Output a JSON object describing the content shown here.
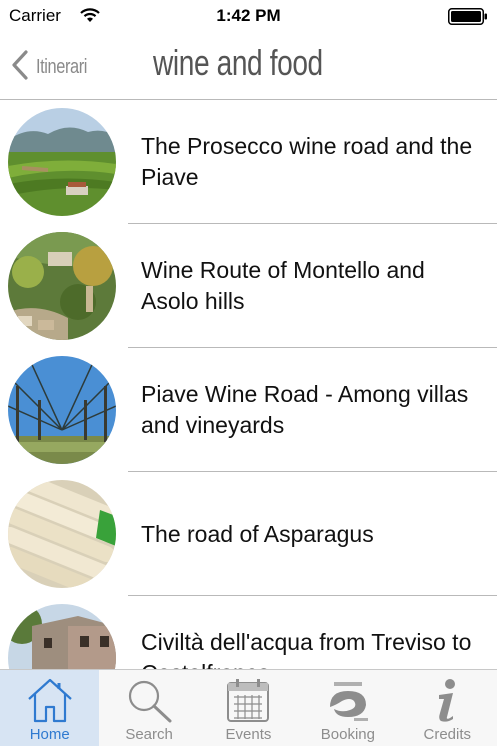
{
  "status_bar": {
    "carrier": "Carrier",
    "time": "1:42 PM"
  },
  "nav": {
    "back_label": "Itinerari",
    "title": "wine and food"
  },
  "items": [
    {
      "title": "The Prosecco wine road and the Piave",
      "thumb": "vineyard-hills-photo"
    },
    {
      "title": "Wine Route of Montello and Asolo hills",
      "thumb": "hillside-village-photo"
    },
    {
      "title": "Piave Wine Road - Among villas and vineyards",
      "thumb": "vineyard-rows-photo"
    },
    {
      "title": "The road of Asparagus",
      "thumb": "white-asparagus-photo"
    },
    {
      "title": "Civiltà dell'acqua from Treviso to Castelfranco",
      "thumb": "stone-house-photo"
    }
  ],
  "tabs": [
    {
      "label": "Home",
      "icon": "home-icon",
      "active": true
    },
    {
      "label": "Search",
      "icon": "search-icon",
      "active": false
    },
    {
      "label": "Events",
      "icon": "calendar-icon",
      "active": false
    },
    {
      "label": "Booking",
      "icon": "marca-treviso-logo",
      "active": false
    },
    {
      "label": "Credits",
      "icon": "info-icon",
      "active": false
    }
  ],
  "colors": {
    "active_tab": "#2f7ad0",
    "active_tab_bg": "#d7e4f3",
    "inactive_tab": "#8d8d8d",
    "separator": "#b9b9b9"
  }
}
